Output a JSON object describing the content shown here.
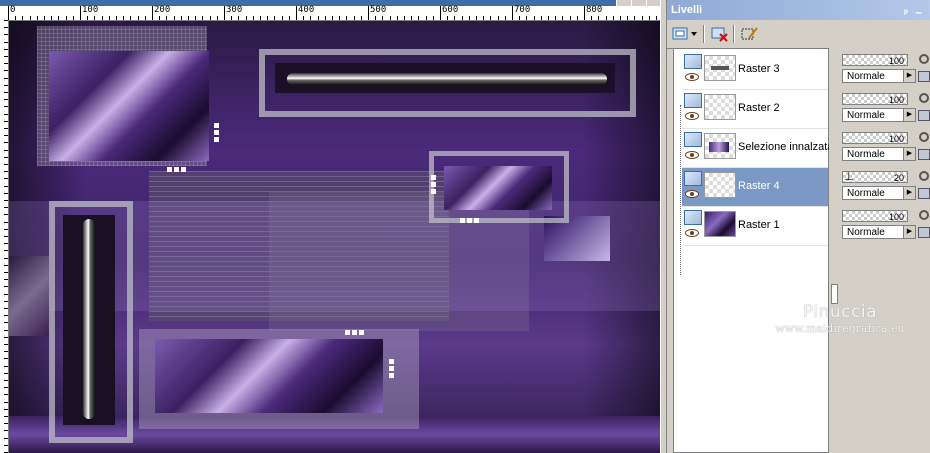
{
  "ruler": {
    "labels": [
      "0",
      "100",
      "200",
      "300",
      "400",
      "500",
      "600",
      "700",
      "800"
    ]
  },
  "watermark": {
    "name": "Pinuccia",
    "url": "www.maidiregrafica.eu"
  },
  "palette": {
    "title": "Livelli",
    "pin_glyph": "ᵖ",
    "min_glyph": "–",
    "toolbar_icons": [
      "new-layer-icon",
      "delete-layer-icon",
      "edit-selection-icon"
    ]
  },
  "layers": [
    {
      "name": "Raster 3",
      "opacity": "100",
      "blend": "Normale",
      "selected": false
    },
    {
      "name": "Raster 2",
      "opacity": "100",
      "blend": "Normale",
      "selected": false
    },
    {
      "name": "Selezione innalzata",
      "opacity": "100",
      "blend": "Normale",
      "selected": false
    },
    {
      "name": "Raster 4",
      "opacity": "20",
      "blend": "Normale",
      "selected": true
    },
    {
      "name": "Raster 1",
      "opacity": "100",
      "blend": "Normale",
      "selected": false
    }
  ],
  "colors": {
    "selection": "#7c98c4",
    "title_bar": "#8ea9d6",
    "artwork_accent": "#4a2a7a"
  }
}
